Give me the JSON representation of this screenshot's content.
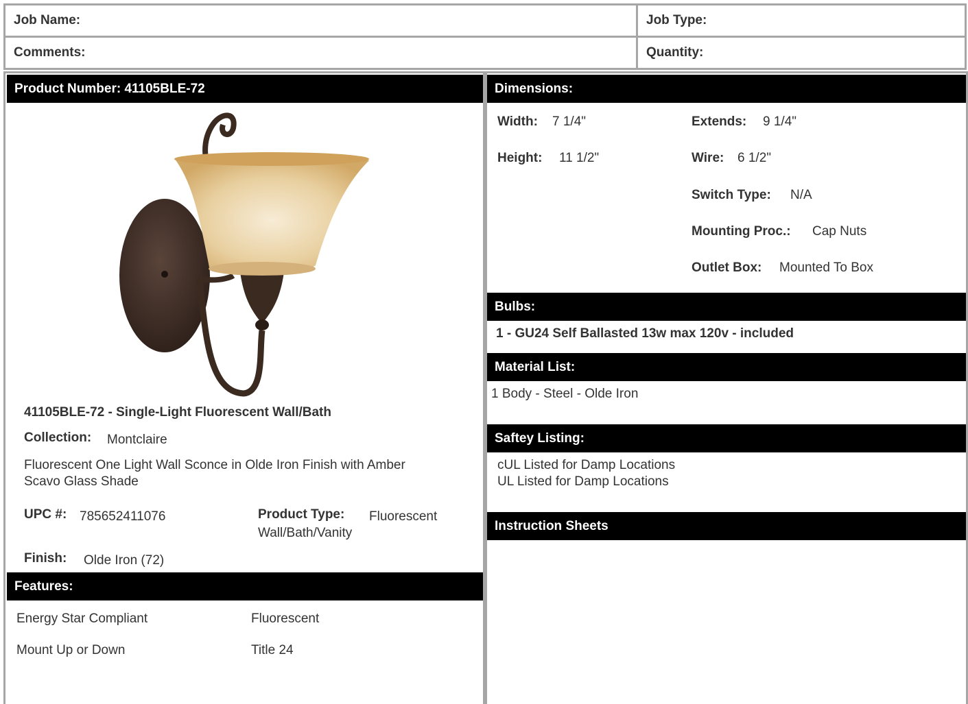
{
  "job_info": {
    "job_name_label": "Job Name:",
    "job_type_label": "Job Type:",
    "comments_label": "Comments:",
    "quantity_label": "Quantity:"
  },
  "product": {
    "header": "Product Number: 41105BLE-72",
    "title": "41105BLE-72 - Single-Light Fluorescent Wall/Bath",
    "collection_label": "Collection:",
    "collection_value": "Montclaire",
    "description_line1": "Fluorescent One Light Wall Sconce in Olde Iron Finish with Amber",
    "description_line2": "Scavo Glass Shade",
    "upc_label": "UPC #:",
    "upc_value": "785652411076",
    "product_type_label": "Product Type:",
    "product_type_value1": "Fluorescent",
    "product_type_value2": "Wall/Bath/Vanity",
    "finish_label": "Finish:",
    "finish_value": "Olde Iron (72)",
    "colors": {
      "glass": "#dcb77c",
      "iron": "#3b2a20"
    }
  },
  "features": {
    "header": "Features:",
    "items": [
      "Energy Star Compliant",
      "Fluorescent",
      "Mount Up or Down",
      "Title 24"
    ]
  },
  "dimensions": {
    "header": "Dimensions:",
    "width_label": "Width:",
    "width_value": "7 1/4\"",
    "height_label": "Height:",
    "height_value": "11 1/2\"",
    "extends_label": "Extends:",
    "extends_value": "9 1/4\"",
    "wire_label": "Wire:",
    "wire_value": "6 1/2\"",
    "switch_label": "Switch Type:",
    "switch_value": "N/A",
    "mounting_label": "Mounting Proc.:",
    "mounting_value": "Cap Nuts",
    "outlet_label": "Outlet Box:",
    "outlet_value": "Mounted To Box"
  },
  "bulbs": {
    "header": "Bulbs:",
    "item": "1 - GU24 Self Ballasted 13w max 120v - included"
  },
  "materials": {
    "header": "Material List:",
    "item": "1 Body - Steel - Olde Iron"
  },
  "safety": {
    "header": "Saftey Listing:",
    "line1": "cUL Listed for Damp Locations",
    "line2": "UL Listed for Damp Locations"
  },
  "instructions": {
    "header": "Instruction Sheets"
  }
}
